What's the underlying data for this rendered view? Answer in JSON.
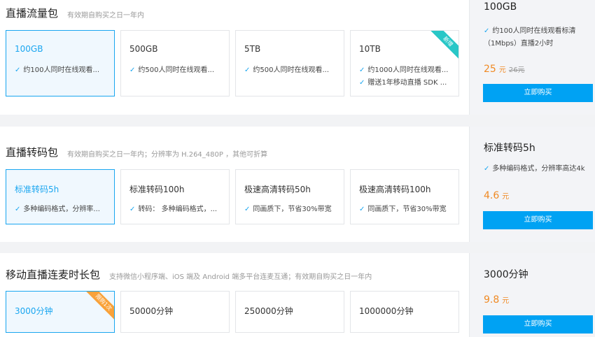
{
  "colors": {
    "accent": "#1aa6f0",
    "price": "#f08a24",
    "ribbon_new": "#29c7c7",
    "ribbon_limit": "#f9a23a",
    "buy_button": "#00a2f3"
  },
  "traffic": {
    "title": "直播流量包",
    "subtitle": "有效期自购买之日一年内",
    "cards": [
      {
        "name": "100GB",
        "features": [
          "约100人同时在线观看..."
        ],
        "selected": true
      },
      {
        "name": "500GB",
        "features": [
          "约500人同时在线观看..."
        ]
      },
      {
        "name": "5TB",
        "features": [
          "约500人同时在线观看..."
        ]
      },
      {
        "name": "10TB",
        "features": [
          "约1000人同时在线观看...",
          "赠送1年移动直播 SDK ..."
        ],
        "ribbon": "新增"
      }
    ],
    "summary": {
      "name": "100GB",
      "feature": "约100人同时在线观看标清（1Mbps）直播2小时",
      "price": "25",
      "unit": "元",
      "original": "26元",
      "buy": "立即购买"
    }
  },
  "transcode": {
    "title": "直播转码包",
    "subtitle": "有效期自购买之日一年内；分辨率为 H.264_480P ，其他可折算",
    "cards": [
      {
        "name": "标准转码5h",
        "features": [
          "多种编码格式，分辨率..."
        ],
        "selected": true
      },
      {
        "name": "标准转码100h",
        "features": [
          "转码：  多种编码格式，..."
        ]
      },
      {
        "name": "极速高清转码50h",
        "features": [
          "同画质下，节省30%带宽"
        ]
      },
      {
        "name": "极速高清转码100h",
        "features": [
          "同画质下，节省30%带宽"
        ]
      }
    ],
    "summary": {
      "name": "标准转码5h",
      "feature": "多种编码格式，分辨率高达4k",
      "price": "4.6",
      "unit": "元",
      "buy": "立即购买"
    }
  },
  "mic": {
    "title": "移动直播连麦时长包",
    "subtitle": "支持微信小程序端、iOS 端及 Android 端多平台连麦互通；有效期自购买之日一年内",
    "cards": [
      {
        "name": "3000分钟",
        "selected": true,
        "ribbon": "限购1次"
      },
      {
        "name": "50000分钟"
      },
      {
        "name": "250000分钟"
      },
      {
        "name": "1000000分钟"
      }
    ],
    "summary": {
      "name": "3000分钟",
      "price": "9.8",
      "unit": "元",
      "buy": "立即购买"
    }
  }
}
